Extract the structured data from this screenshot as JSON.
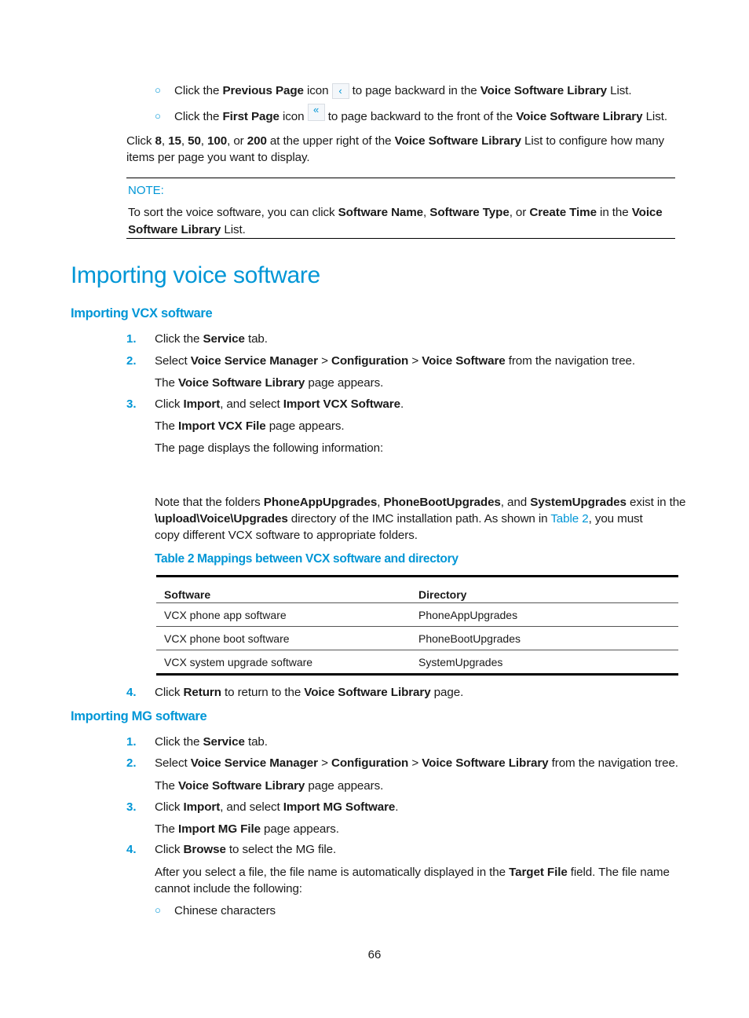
{
  "top_bullets": [
    {
      "pre": "Click the ",
      "bold": "Previous Page",
      "mid": " icon ",
      "icon": "‹",
      "icon_name": "previous-page-icon",
      "post": " to page backward in the ",
      "bold2": "Voice Software Library",
      "end": " List."
    },
    {
      "pre": "Click the ",
      "bold": "First Page",
      "mid": " icon ",
      "icon": "«",
      "icon_name": "first-page-icon",
      "post": " to page backward to the front of the ",
      "bold2": "Voice Software Library",
      "end": " List."
    }
  ],
  "items_per_page": {
    "line1": {
      "t0": "Click ",
      "b1": "8",
      "t1": ", ",
      "b2": "15",
      "t2": ", ",
      "b3": "50",
      "t3": ", ",
      "b4": "100",
      "t4": ", or ",
      "b5": "200",
      "t5": " at the upper right of the ",
      "b6": "Voice Software Library",
      "t6": " List to configure how many"
    },
    "line2": "items per page you want to display."
  },
  "note": {
    "label": "NOTE:",
    "line1": {
      "t0": "To sort the voice software, you can click ",
      "b1": "Software Name",
      "t1": ", ",
      "b2": "Software Type",
      "t2": ", or ",
      "b3": "Create Time",
      "t3": " in the ",
      "b4": "Voice"
    },
    "line2": {
      "b1": "Software Library",
      "t1": " List."
    }
  },
  "section_title": "Importing voice software",
  "vcx": {
    "heading": "Importing VCX software",
    "steps": [
      {
        "num": "1.",
        "t0": "Click the ",
        "b1": "Service",
        "t1": " tab."
      },
      {
        "num": "2.",
        "t0": "Select ",
        "b1": "Voice Service Manager",
        "t1": " > ",
        "b2": "Configuration",
        "t2": " > ",
        "b3": "Voice Software",
        "t3": " from the navigation tree."
      },
      {
        "t0": "The ",
        "b1": "Voice Software Library",
        "t1": " page appears."
      },
      {
        "num": "3.",
        "t0": "Click ",
        "b1": "Import",
        "t1": ", and select ",
        "b2": "Import VCX Software",
        "t2": "."
      },
      {
        "t0": "The ",
        "b1": "Import VCX File",
        "t1": " page appears."
      },
      {
        "t0": "The page displays the following information:"
      }
    ],
    "folders_note": {
      "line1": {
        "t0": "Note that the folders ",
        "b1": "PhoneAppUpgrades",
        "t1": ", ",
        "b2": "PhoneBootUpgrades",
        "t2": ", and ",
        "b3": "SystemUpgrades",
        "t3": " exist in the"
      },
      "line2": {
        "b1": "\\upload\\Voice\\Upgrades",
        "t1": " directory of the IMC installation path. As shown in ",
        "link": "Table 2",
        "t2": ", you must"
      },
      "line3": "copy different VCX software to appropriate folders."
    },
    "table": {
      "caption": "Table 2 Mappings between VCX software and directory",
      "headers": [
        "Software",
        "Directory"
      ],
      "rows": [
        [
          "VCX phone app software",
          "PhoneAppUpgrades"
        ],
        [
          "VCX phone boot software",
          "PhoneBootUpgrades"
        ],
        [
          "VCX system upgrade software",
          "SystemUpgrades"
        ]
      ]
    },
    "step4": {
      "num": "4.",
      "t0": "Click ",
      "b1": "Return",
      "t1": " to return to the ",
      "b2": "Voice Software Library",
      "t2": " page."
    }
  },
  "mg": {
    "heading": "Importing MG software",
    "steps": [
      {
        "num": "1.",
        "t0": "Click the ",
        "b1": "Service",
        "t1": " tab."
      },
      {
        "num": "2.",
        "t0": "Select ",
        "b1": "Voice Service Manager",
        "t1": " > ",
        "b2": "Configuration",
        "t2": " > ",
        "b3": "Voice Software Library",
        "t3": " from the navigation tree."
      },
      {
        "t0": "The ",
        "b1": "Voice Software Library",
        "t1": " page appears."
      },
      {
        "num": "3.",
        "t0": "Click ",
        "b1": "Import",
        "t1": ", and select ",
        "b2": "Import MG Software",
        "t2": "."
      },
      {
        "t0": "The ",
        "b1": "Import MG File",
        "t1": " page appears."
      },
      {
        "num": "4.",
        "t0": "Click ",
        "b1": "Browse",
        "t1": " to select the MG file."
      }
    ],
    "after_select": {
      "line1": {
        "t0": "After you select a file, the file name is automatically displayed in the ",
        "b1": "Target File",
        "t1": " field. The file name"
      },
      "line2": "cannot include the following:"
    },
    "sub_bullets": [
      "Chinese characters"
    ]
  },
  "page_number": "66"
}
